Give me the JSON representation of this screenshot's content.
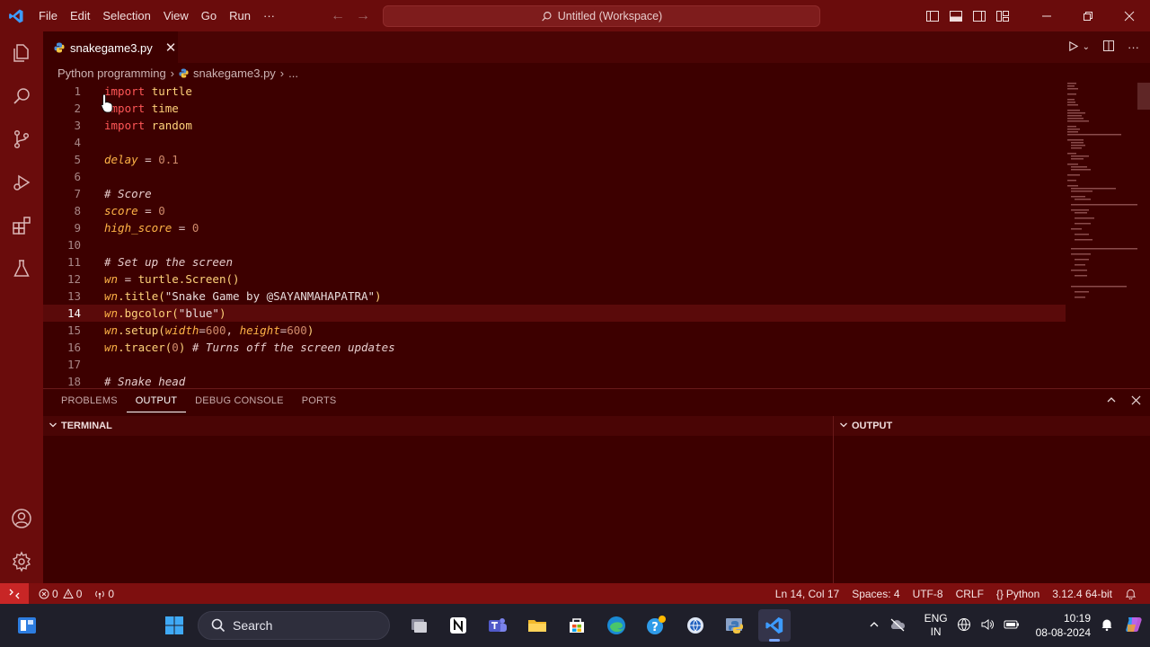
{
  "titlebar": {
    "menu": [
      "File",
      "Edit",
      "Selection",
      "View",
      "Go",
      "Run",
      "···"
    ],
    "search_text": "Untitled (Workspace)",
    "accent": "#6a0c0c"
  },
  "tab": {
    "filename": "snakegame3.py"
  },
  "breadcrumb": {
    "folder": "Python programming",
    "file": "snakegame3.py",
    "more": "..."
  },
  "code": {
    "line_numbers": [
      "1",
      "2",
      "3",
      "4",
      "5",
      "6",
      "7",
      "8",
      "9",
      "10",
      "11",
      "12",
      "13",
      "14",
      "15",
      "16",
      "17",
      "18"
    ],
    "l1": {
      "kw": "import",
      "mod": "turtle"
    },
    "l2": {
      "kw": "import",
      "mod": "time"
    },
    "l3": {
      "kw": "import",
      "mod": "random"
    },
    "l5": {
      "var": "delay",
      "op": " = ",
      "num": "0.1"
    },
    "l7": {
      "cmt": "# Score"
    },
    "l8": {
      "var": "score",
      "op": " = ",
      "num": "0"
    },
    "l9": {
      "var": "high_score",
      "op": " = ",
      "num": "0"
    },
    "l11": {
      "cmt": "# Set up the screen"
    },
    "l12": {
      "var": "wn",
      "op": " = ",
      "fn": "turtle.Screen()"
    },
    "l13": {
      "var": "wn",
      "fn": ".title(",
      "str": "\"Snake Game by @SAYANMAHAPATRA\"",
      "close": ")"
    },
    "l14": {
      "var": "wn",
      "fn": ".bgcolor(",
      "str": "\"blue\"",
      "close": ")"
    },
    "l15": {
      "var": "wn",
      "fn": ".setup(",
      "p1": "width",
      "eq1": "=",
      "n1": "600",
      "sep": ", ",
      "p2": "height",
      "eq2": "=",
      "n2": "600",
      "close": ")"
    },
    "l16": {
      "var": "wn",
      "fn": ".tracer(",
      "num": "0",
      "close": ")",
      "cmt": " # Turns off the screen updates"
    },
    "l18": {
      "cmt": "# Snake head"
    }
  },
  "panel": {
    "tabs": [
      "PROBLEMS",
      "OUTPUT",
      "DEBUG CONSOLE",
      "PORTS"
    ],
    "terminal_title": "TERMINAL",
    "output_title": "OUTPUT"
  },
  "statusbar": {
    "errors": "0",
    "warnings": "0",
    "ports": "0",
    "position": "Ln 14, Col 17",
    "spaces": "Spaces: 4",
    "encoding": "UTF-8",
    "eol": "CRLF",
    "language": "Python",
    "interpreter": "3.12.4 64-bit"
  },
  "taskbar": {
    "search_label": "Search",
    "lang_top": "ENG",
    "lang_bottom": "IN",
    "time": "10:19",
    "date": "08-08-2024"
  }
}
